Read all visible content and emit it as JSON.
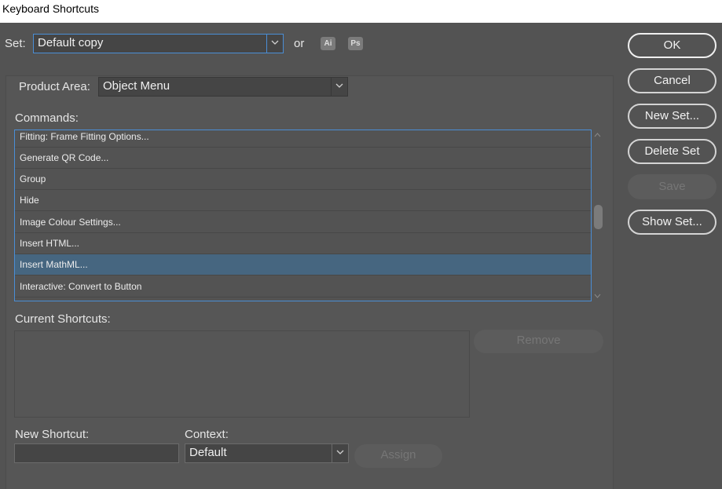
{
  "window": {
    "title": "Keyboard Shortcuts"
  },
  "set": {
    "label": "Set:",
    "value": "Default copy",
    "or_label": "or",
    "import_icons": [
      "Ai",
      "Ps"
    ]
  },
  "product_area": {
    "label": "Product Area:",
    "value": "Object Menu"
  },
  "commands": {
    "label": "Commands:",
    "items": [
      {
        "label": "Fitting: Frame Fitting Options...",
        "selected": false
      },
      {
        "label": "Generate QR Code...",
        "selected": false
      },
      {
        "label": "Group",
        "selected": false
      },
      {
        "label": "Hide",
        "selected": false
      },
      {
        "label": "Image Colour Settings...",
        "selected": false
      },
      {
        "label": "Insert HTML...",
        "selected": false
      },
      {
        "label": "Insert MathML...",
        "selected": true
      },
      {
        "label": "Interactive: Convert to Button",
        "selected": false
      }
    ]
  },
  "current_shortcuts": {
    "label": "Current Shortcuts:",
    "remove_label": "Remove"
  },
  "new_shortcut": {
    "label": "New Shortcut:",
    "value": ""
  },
  "context": {
    "label": "Context:",
    "value": "Default"
  },
  "assign_label": "Assign",
  "side_buttons": {
    "ok": "OK",
    "cancel": "Cancel",
    "new_set": "New Set...",
    "delete_set": "Delete Set",
    "save": "Save",
    "show_set": "Show Set..."
  }
}
